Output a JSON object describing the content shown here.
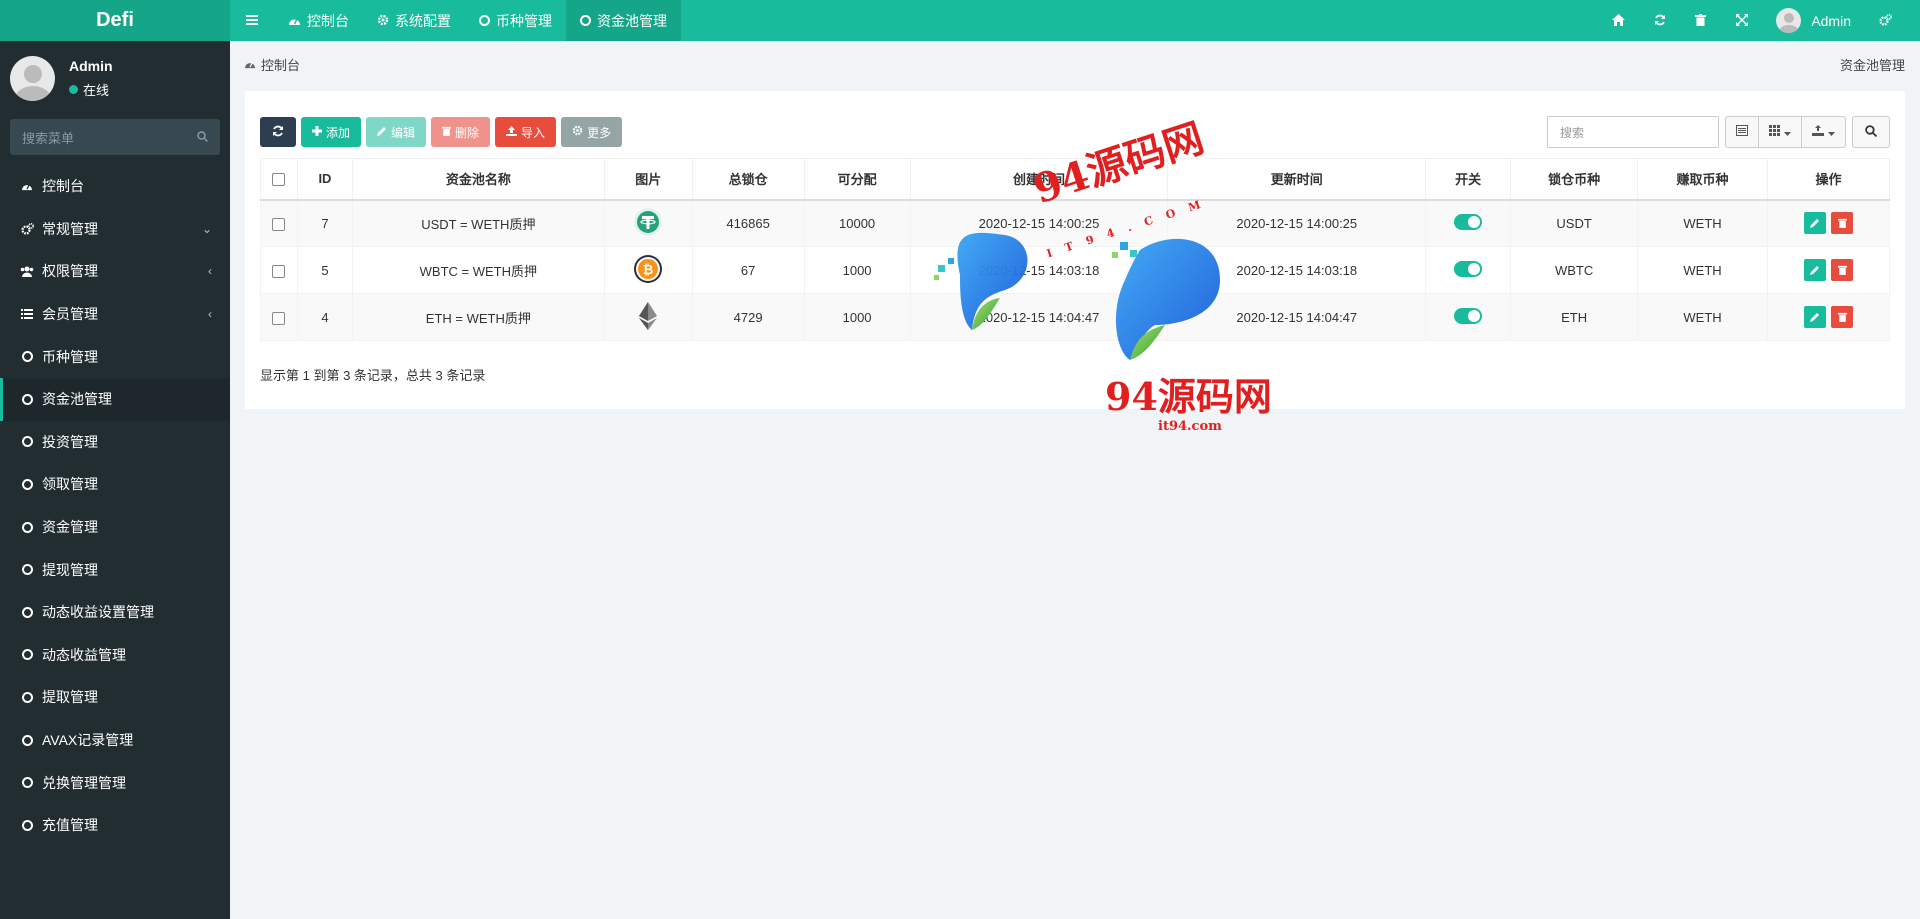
{
  "app": {
    "logo": "Defi"
  },
  "topnav": {
    "tabs": [
      {
        "label": "控制台",
        "icon": "dashboard-icon"
      },
      {
        "label": "系统配置",
        "icon": "cogs-icon"
      },
      {
        "label": "币种管理",
        "icon": "circle-icon"
      },
      {
        "label": "资金池管理",
        "icon": "circle-icon",
        "active": true
      }
    ],
    "user_name": "Admin"
  },
  "sidebar": {
    "user_name": "Admin",
    "status": "在线",
    "search_placeholder": "搜索菜单",
    "items": [
      {
        "label": "控制台",
        "icon": "dashboard-icon"
      },
      {
        "label": "常规管理",
        "icon": "cogs-icon",
        "arrow": "⌄"
      },
      {
        "label": "权限管理",
        "icon": "group-icon",
        "arrow": "‹"
      },
      {
        "label": "会员管理",
        "icon": "list-icon",
        "arrow": "‹"
      },
      {
        "label": "币种管理",
        "icon": "circle-icon"
      },
      {
        "label": "资金池管理",
        "icon": "circle-icon",
        "active": true
      },
      {
        "label": "投资管理",
        "icon": "circle-icon"
      },
      {
        "label": "领取管理",
        "icon": "circle-icon"
      },
      {
        "label": "资金管理",
        "icon": "circle-icon"
      },
      {
        "label": "提现管理",
        "icon": "circle-icon"
      },
      {
        "label": "动态收益设置管理",
        "icon": "circle-icon"
      },
      {
        "label": "动态收益管理",
        "icon": "circle-icon"
      },
      {
        "label": "提取管理",
        "icon": "circle-icon"
      },
      {
        "label": "AVAX记录管理",
        "icon": "circle-icon"
      },
      {
        "label": "兑换管理管理",
        "icon": "circle-icon"
      },
      {
        "label": "充值管理",
        "icon": "circle-icon"
      }
    ]
  },
  "breadcrumb": {
    "home": "控制台",
    "current": "资金池管理"
  },
  "toolbar": {
    "add": "添加",
    "edit": "编辑",
    "delete": "删除",
    "import": "导入",
    "more": "更多",
    "search_placeholder": "搜索"
  },
  "table": {
    "columns": [
      "ID",
      "资金池名称",
      "图片",
      "总锁仓",
      "可分配",
      "创建时间",
      "更新时间",
      "开关",
      "锁仓币种",
      "赚取币种",
      "操作"
    ],
    "rows": [
      {
        "id": "7",
        "name": "USDT = WETH质押",
        "image": "tether-icon",
        "total": "416865",
        "alloc": "10000",
        "created": "2020-12-15 14:00:25",
        "updated": "2020-12-15 14:00:25",
        "switch": true,
        "lock": "USDT",
        "earn": "WETH"
      },
      {
        "id": "5",
        "name": "WBTC = WETH质押",
        "image": "bitcoin-icon",
        "total": "67",
        "alloc": "1000",
        "created": "2020-12-15 14:03:18",
        "updated": "2020-12-15 14:03:18",
        "switch": true,
        "lock": "WBTC",
        "earn": "WETH"
      },
      {
        "id": "4",
        "name": "ETH = WETH质押",
        "image": "ethereum-icon",
        "total": "4729",
        "alloc": "1000",
        "created": "2020-12-15 14:04:47",
        "updated": "2020-12-15 14:04:47",
        "switch": true,
        "lock": "ETH",
        "earn": "WETH"
      }
    ]
  },
  "pagination_info": "显示第 1 到第 3 条记录，总共 3 条记录",
  "watermark": {
    "title": "94源码网",
    "sub": "IT94.COM",
    "site": "it94.com"
  },
  "colors": {
    "primary": "#18bc9c",
    "sidebar": "#222d32",
    "danger": "#e74c3c",
    "dark": "#2c3e50"
  }
}
